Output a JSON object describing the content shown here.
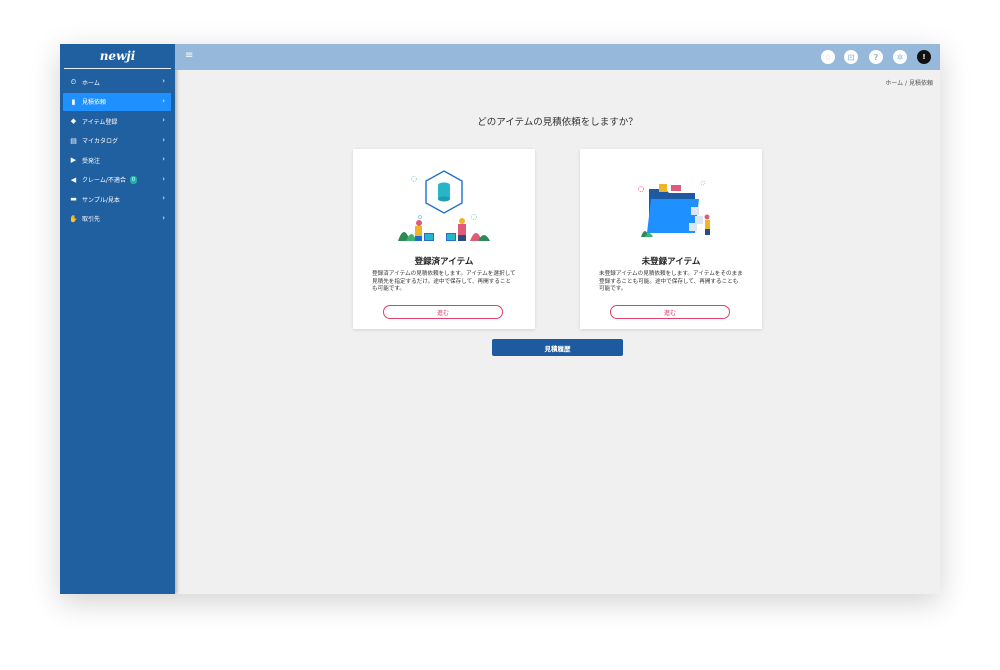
{
  "app": {
    "logo": "newji"
  },
  "sidebar": {
    "items": [
      {
        "label": "ホーム",
        "icon": "dashboard-icon",
        "glyph": "⏲",
        "active": false
      },
      {
        "label": "見積依頼",
        "icon": "document-icon",
        "glyph": "▮",
        "active": true
      },
      {
        "label": "アイテム登録",
        "icon": "gem-icon",
        "glyph": "◆",
        "active": false
      },
      {
        "label": "マイカタログ",
        "icon": "catalog-icon",
        "glyph": "▤",
        "active": false
      },
      {
        "label": "受発注",
        "icon": "truck-icon",
        "glyph": "▶",
        "active": false
      },
      {
        "label": "クレーム/不適合",
        "icon": "megaphone-icon",
        "glyph": "◀",
        "active": false,
        "badge": "0"
      },
      {
        "label": "サンプル/見本",
        "icon": "book-icon",
        "glyph": "▬",
        "active": false
      },
      {
        "label": "取引先",
        "icon": "handshake-icon",
        "glyph": "✋",
        "active": false
      }
    ]
  },
  "topbar": {
    "menu_glyph": "≡",
    "icons": [
      {
        "name": "bell-icon",
        "glyph": "♢"
      },
      {
        "name": "chart-icon",
        "glyph": "⊡"
      },
      {
        "name": "help-icon",
        "glyph": "?"
      },
      {
        "name": "gear-icon",
        "glyph": "✲"
      },
      {
        "name": "user-avatar",
        "glyph": "!"
      }
    ]
  },
  "breadcrumb": {
    "home": "ホーム",
    "separator": "/",
    "current": "見積依頼"
  },
  "main": {
    "question": "どのアイテムの見積依頼をしますか？",
    "cards": [
      {
        "title": "登録済アイテム",
        "description": "登録済アイテムの見積依頼をします。アイテムを選択して見積先を指定するだけ。途中で保存して、再開することも可能です。",
        "button": "進む"
      },
      {
        "title": "未登録アイテム",
        "description": "未登録アイテムの見積依頼をします。アイテムをそのまま登録することも可能。途中で保存して、再開することも可能です。",
        "button": "進む"
      }
    ],
    "history_button": "見積履歴"
  },
  "colors": {
    "sidebar": "#2060a0",
    "sidebar_active": "#1e90ff",
    "topbar": "#96b8da",
    "accent_pink": "#e0406a",
    "history_button": "#1e5aa0"
  }
}
